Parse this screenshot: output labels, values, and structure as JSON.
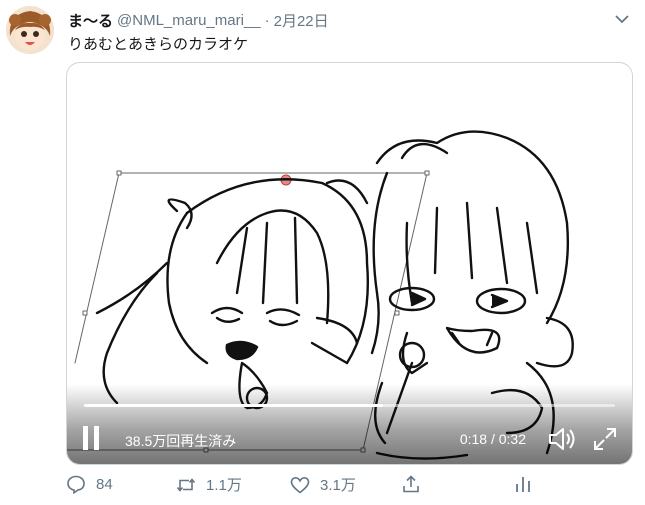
{
  "tweet": {
    "display_name": "ま〜る",
    "handle": "@NML_maru_mari__",
    "separator": "·",
    "date": "2月22日",
    "text": "りあむとあきらのカラオケ"
  },
  "video": {
    "views": "38.5万回再生済み",
    "time": "0:18 / 0:32",
    "progress": 0.5625,
    "state": "playing"
  },
  "actions": {
    "replies": "84",
    "retweets": "1.1万",
    "likes": "3.1万"
  },
  "colors": {
    "secondary_text": "#657786",
    "border": "#ccd6dd",
    "text": "#14171a"
  },
  "icons": [
    "avatar",
    "chevron-down-icon",
    "pause-icon",
    "volume-icon",
    "fullscreen-icon",
    "reply-icon",
    "retweet-icon",
    "like-icon",
    "share-icon",
    "analytics-icon"
  ]
}
